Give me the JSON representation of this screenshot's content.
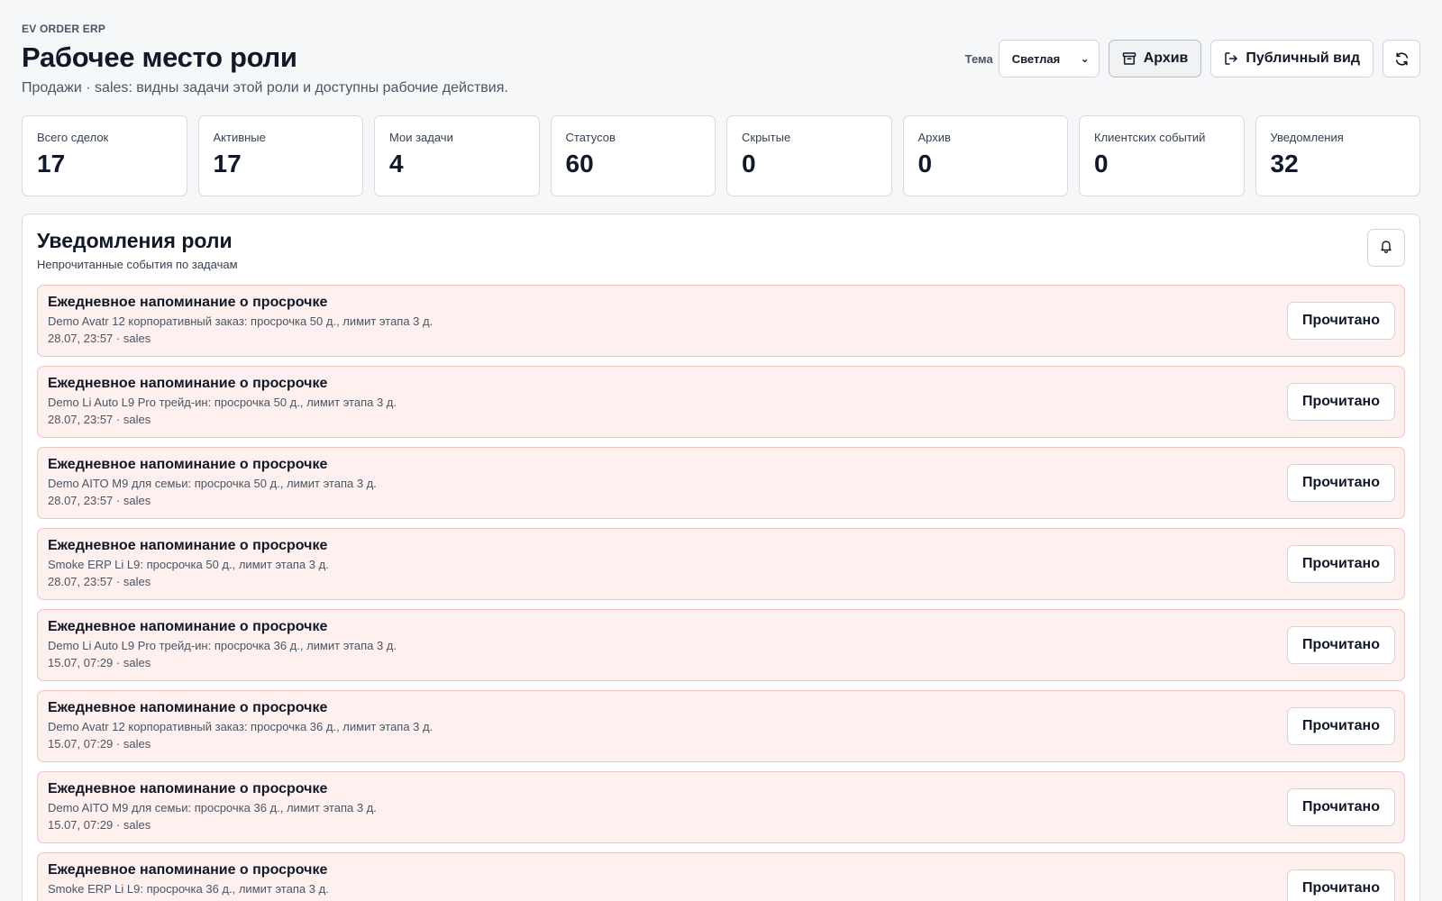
{
  "header": {
    "brand": "EV ORDER ERP",
    "title": "Рабочее место роли",
    "subtitle": "Продажи · sales: видны задачи этой роли и доступны рабочие действия.",
    "theme_label": "Тема",
    "theme_value": "Светлая",
    "archive_label": "Архив",
    "public_view_label": "Публичный вид",
    "icons": {
      "archive": "archive-icon",
      "public_view": "logout-icon",
      "refresh": "refresh-icon"
    }
  },
  "stats": [
    {
      "label": "Всего сделок",
      "value": "17"
    },
    {
      "label": "Активные",
      "value": "17"
    },
    {
      "label": "Мои задачи",
      "value": "4"
    },
    {
      "label": "Статусов",
      "value": "60"
    },
    {
      "label": "Скрытые",
      "value": "0"
    },
    {
      "label": "Архив",
      "value": "0"
    },
    {
      "label": "Клиентских событий",
      "value": "0"
    },
    {
      "label": "Уведомления",
      "value": "32"
    }
  ],
  "notifications": {
    "title": "Уведомления роли",
    "subtitle": "Непрочитанные события по задачам",
    "bell_icon": "bell-icon",
    "read_label": "Прочитано",
    "items": [
      {
        "title": "Ежедневное напоминание о просрочке",
        "desc": "Demo Avatr 12 корпоративный заказ: просрочка 50 д., лимит этапа 3 д.",
        "meta": "28.07, 23:57 · sales"
      },
      {
        "title": "Ежедневное напоминание о просрочке",
        "desc": "Demo Li Auto L9 Pro трейд-ин: просрочка 50 д., лимит этапа 3 д.",
        "meta": "28.07, 23:57 · sales"
      },
      {
        "title": "Ежедневное напоминание о просрочке",
        "desc": "Demo AITO M9 для семьи: просрочка 50 д., лимит этапа 3 д.",
        "meta": "28.07, 23:57 · sales"
      },
      {
        "title": "Ежедневное напоминание о просрочке",
        "desc": "Smoke ERP Li L9: просрочка 50 д., лимит этапа 3 д.",
        "meta": "28.07, 23:57 · sales"
      },
      {
        "title": "Ежедневное напоминание о просрочке",
        "desc": "Demo Li Auto L9 Pro трейд-ин: просрочка 36 д., лимит этапа 3 д.",
        "meta": "15.07, 07:29 · sales"
      },
      {
        "title": "Ежедневное напоминание о просрочке",
        "desc": "Demo Avatr 12 корпоративный заказ: просрочка 36 д., лимит этапа 3 д.",
        "meta": "15.07, 07:29 · sales"
      },
      {
        "title": "Ежедневное напоминание о просрочке",
        "desc": "Demo AITO M9 для семьи: просрочка 36 д., лимит этапа 3 д.",
        "meta": "15.07, 07:29 · sales"
      },
      {
        "title": "Ежедневное напоминание о просрочке",
        "desc": "Smoke ERP Li L9: просрочка 36 д., лимит этапа 3 д.",
        "meta": ""
      }
    ]
  }
}
